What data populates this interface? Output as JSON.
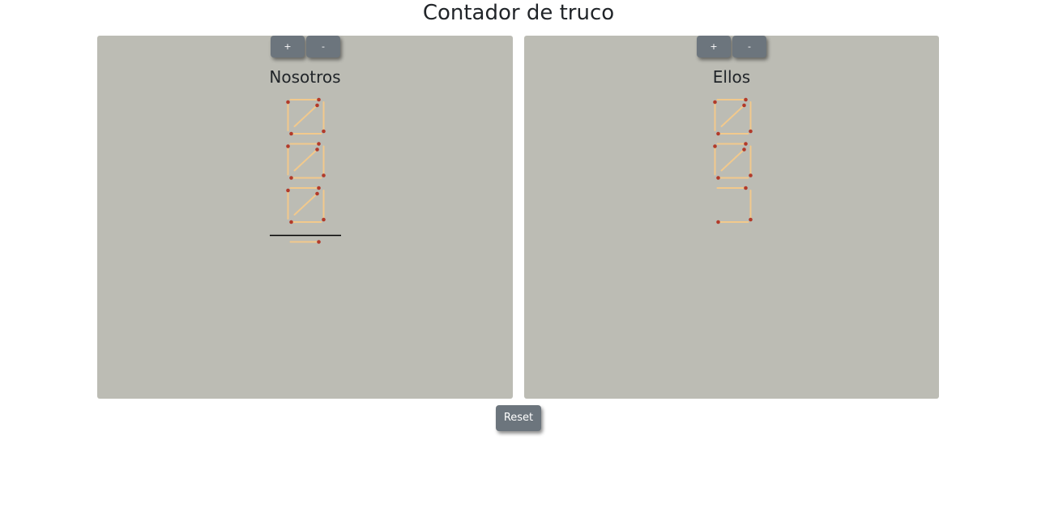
{
  "title": "Contador de truco",
  "buttons": {
    "plus": "+",
    "minus": "-",
    "reset": "Reset"
  },
  "teams": [
    {
      "name": "Nosotros",
      "points": 16
    },
    {
      "name": "Ellos",
      "points": 13
    }
  ],
  "colors": {
    "panel": "#bcbcb4",
    "match_stick": "#f2c98c",
    "match_head": "#b23a2a",
    "button": "#6c757d"
  }
}
